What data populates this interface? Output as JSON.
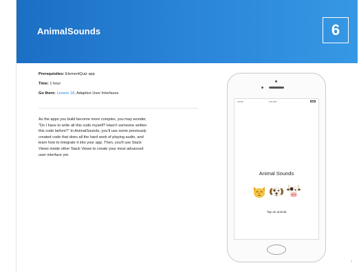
{
  "header": {
    "title": "AnimalSounds",
    "number": "6"
  },
  "meta": {
    "prerequisites_label": "Prerequisites:",
    "prerequisites_value": "ElementQuiz app",
    "time_label": "Time:",
    "time_value": "1 hour",
    "go_there_label": "Go there:",
    "go_there_link": "Lesson 18",
    "go_there_value": ", Adaptive User Interfaces"
  },
  "body": {
    "lines": [
      "As the apps you build become more complex, you may wonder,",
      "“Do I have to write all this code myself? Hasn’t someone written",
      "this code before?” In AnimalSounds, you’ll use some previously",
      "created code that does all the hard work of playing audio, and",
      "learn how to integrate it into your app. Then, you’ll use Stack",
      "Views inside other Stack Views to create your most advanced",
      "user interface yet."
    ]
  },
  "phone": {
    "status_carrier": "Carrier",
    "status_time": "9:41 AM",
    "app_title": "Animal Sounds",
    "animals": [
      {
        "name": "cat",
        "icon": "cat-face-icon"
      },
      {
        "name": "dog",
        "icon": "dog-face-icon"
      },
      {
        "name": "cow",
        "icon": "cow-face-icon"
      }
    ],
    "prompt": "Tap an animal"
  },
  "page_number": "7",
  "colors": {
    "header_start": "#1b6fc4",
    "header_end": "#3698e4",
    "link": "#2a84d8"
  }
}
